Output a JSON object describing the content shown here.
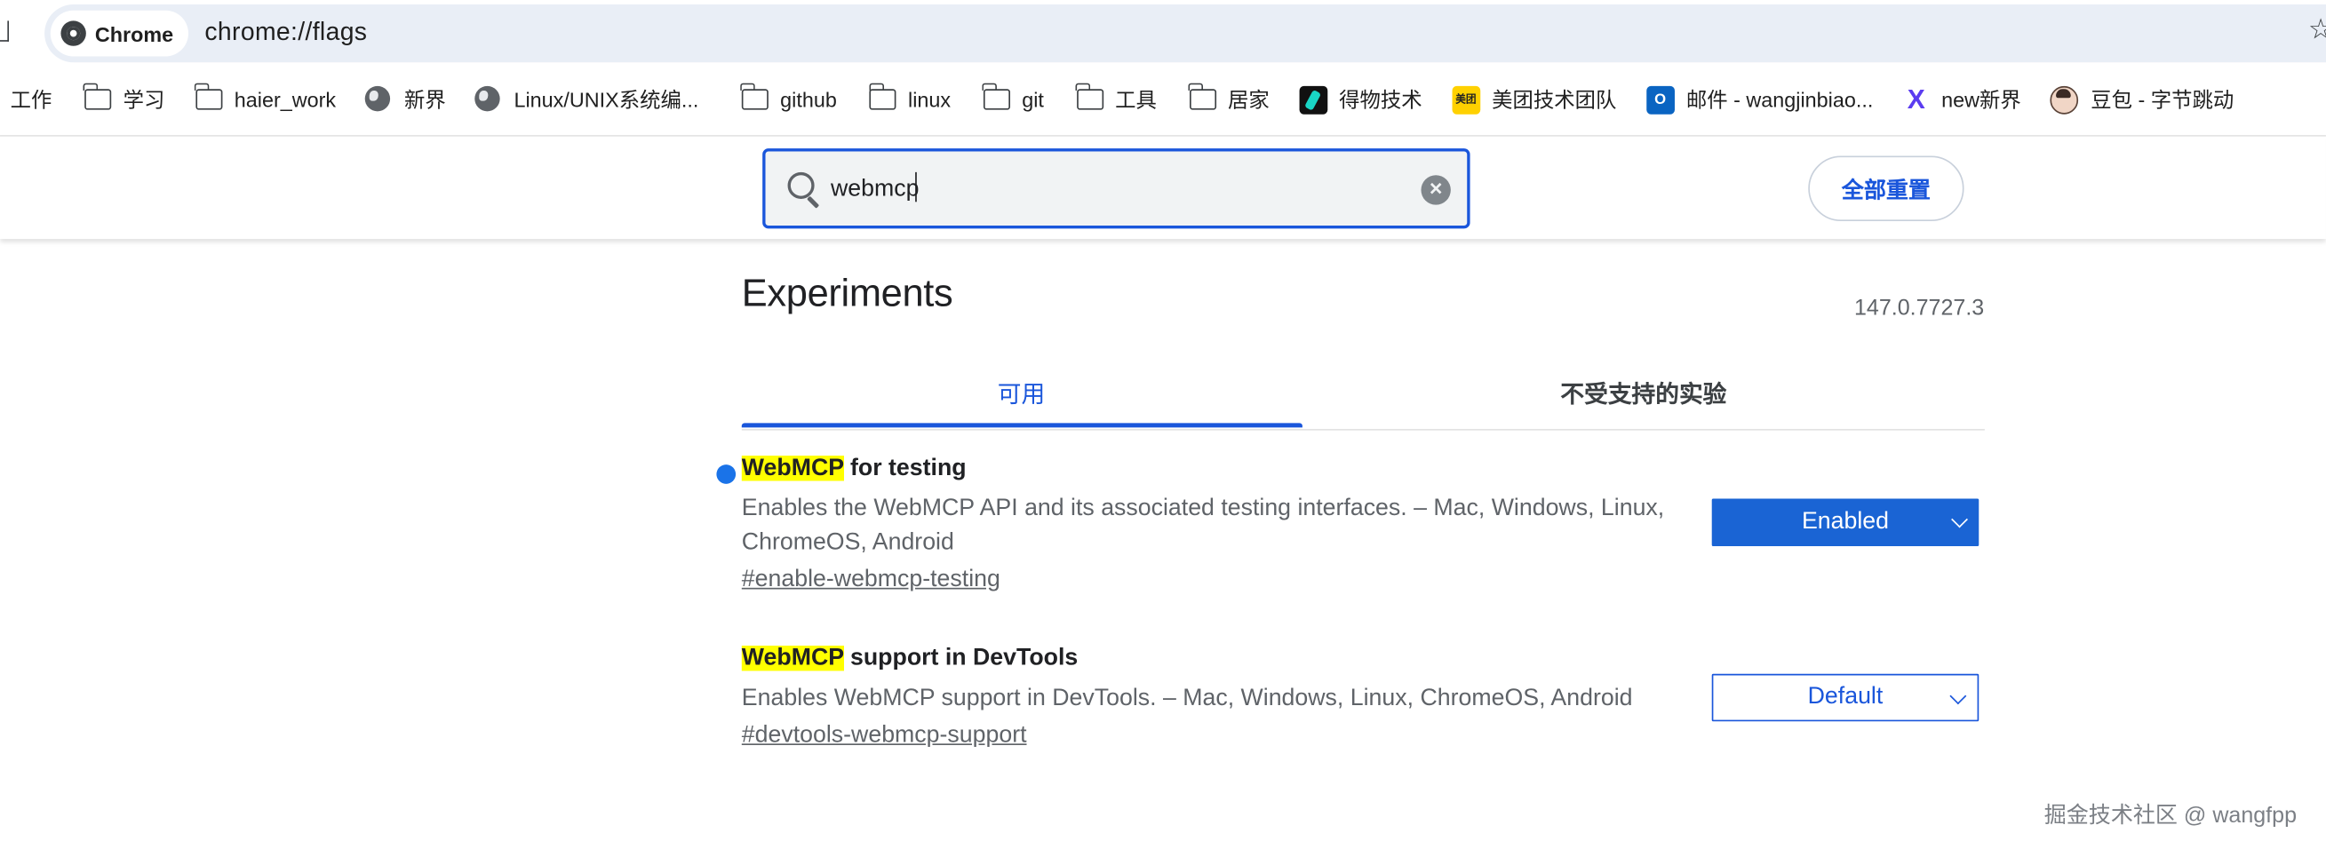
{
  "browser": {
    "chip_label": "Chrome",
    "url": "chrome://flags"
  },
  "bookmarks": [
    {
      "label": "工作",
      "icon": "none"
    },
    {
      "label": "学习",
      "icon": "folder-icon"
    },
    {
      "label": "haier_work",
      "icon": "folder-icon"
    },
    {
      "label": "新界",
      "icon": "globe-icon"
    },
    {
      "label": "Linux/UNIX系统编...",
      "icon": "globe-icon"
    },
    {
      "label": "github",
      "icon": "folder-icon"
    },
    {
      "label": "linux",
      "icon": "folder-icon"
    },
    {
      "label": "git",
      "icon": "folder-icon"
    },
    {
      "label": "工具",
      "icon": "folder-icon"
    },
    {
      "label": "居家",
      "icon": "folder-icon"
    },
    {
      "label": "得物技术",
      "icon": "dewu-icon"
    },
    {
      "label": "美团技术团队",
      "icon": "meituan-icon"
    },
    {
      "label": "邮件 - wangjinbiao...",
      "icon": "outlook-icon"
    },
    {
      "label": "new新界",
      "icon": "x-icon"
    },
    {
      "label": "豆包 - 字节跳动",
      "icon": "doubao-icon"
    }
  ],
  "search": {
    "value": "webmcp",
    "clear_symbol": "×"
  },
  "reset_button_label": "全部重置",
  "page": {
    "title": "Experiments",
    "version": "147.0.7727.3"
  },
  "tabs": {
    "available": "可用",
    "unavailable": "不受支持的实验"
  },
  "flags": [
    {
      "highlight": "WebMCP",
      "name_rest": " for testing",
      "description": "Enables the WebMCP API and its associated testing interfaces. – Mac, Windows, Linux, ChromeOS, Android",
      "link": "#enable-webmcp-testing",
      "state": "Enabled",
      "modified": true
    },
    {
      "highlight": "WebMCP",
      "name_rest": " support in DevTools",
      "description": "Enables WebMCP support in DevTools. – Mac, Windows, Linux, ChromeOS, Android",
      "link": "#devtools-webmcp-support",
      "state": "Default",
      "modified": false
    }
  ],
  "watermark": "掘金技术社区 @ wangfpp",
  "colors": {
    "accent": "#1a56db",
    "enabled_select": "#1a64d4",
    "highlight": "#ffff00",
    "modified_dot": "#1a73e8"
  }
}
